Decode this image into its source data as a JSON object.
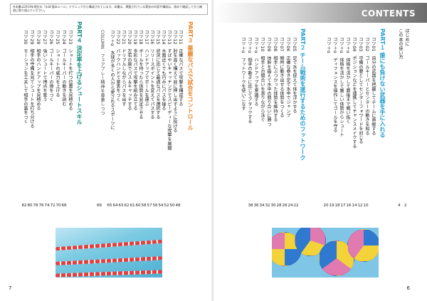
{
  "header": {
    "title": "CONTENTS",
    "note": "※本書は2019年現在の「水球 基本ルール」テクニックから構成されています。本書は、掲載されている実技の内容や構成は、改めて確認してから練習に取り組んでください。"
  },
  "intro": {
    "items": [
      {
        "label": "はじめに",
        "page": "2"
      },
      {
        "label": "この本の使い方",
        "page": "4"
      }
    ]
  },
  "part1": {
    "title": "PART１ 誰にも負けない武器を手に入れる",
    "entries": [
      {
        "no": "コツ01",
        "text": "自分の武器を把握してチームに貢献する",
        "page": "10"
      },
      {
        "no": "コツ02",
        "text": "ゴールキーパーとセンターの動きを知る",
        "page": "12"
      },
      {
        "no": "コツ03",
        "text": "守備の要としてセンターフォワードを封じる",
        "page": "14"
      },
      {
        "no": "コツ04",
        "text": "ポジションなどを連携してチャンスメイクする",
        "page": "16"
      },
      {
        "no": "コツ＋α",
        "text": "体格を活かして最後まで戦い抜く",
        "page": "17"
      },
      {
        "no": "コツ＋α",
        "text": "体格を活かして厳しい体勢からシュート",
        "page": "18"
      },
      {
        "no": "コツ＋α",
        "text": "ディフェンスを操作してゴールを守る",
        "page": "19"
      },
      {
        "no": "コツ＋α",
        "text": "",
        "page": "20"
      }
    ]
  },
  "part2": {
    "title": "PART２ チーム戦術を遂行するためのフットワーク",
    "entries": [
      {
        "no": "コツ05",
        "text": "足で水を捉えて体を浮かせる",
        "page": "22"
      },
      {
        "no": "コツ06",
        "text": "正確な巻き足で水中でジャンプ",
        "page": "24"
      },
      {
        "no": "コツ07",
        "text": "瞬時に動き出せる体勢をつくる",
        "page": "26"
      },
      {
        "no": "コツ08",
        "text": "相手にぶつかった体勢を維持する",
        "page": "28"
      },
      {
        "no": "コツ09",
        "text": "体幹を鍛えて水中の競り合いに勝つ",
        "page": "30"
      },
      {
        "no": "コツ10",
        "text": "相手との間合いを測りながら泳ぐ",
        "page": "32"
      },
      {
        "no": "コツ＋α",
        "text": "ハンドアップを意識する",
        "page": "34"
      },
      {
        "no": "コツ＋α",
        "text": "相手の動きに応じてアタックする",
        "page": "36"
      },
      {
        "no": "コツ＋α",
        "text": "フットワークを使いこなす",
        "page": "38"
      }
    ]
  },
  "part3": {
    "title": "PART３ 華麗なパスで試合をコントロール",
    "entries": [
      {
        "no": "コツ11",
        "text": "正確なパスで攻撃を構成する",
        "page": "48"
      },
      {
        "no": "コツ12",
        "text": "肘を高く構えて前に押し出すように投げる",
        "page": "50"
      },
      {
        "no": "コツ13",
        "text": "すばやいキャッチングでスピーディーな攻撃を展開",
        "page": "52"
      },
      {
        "no": "コツ14",
        "text": "水面近くでも巧みにパスを操る",
        "page": "54"
      },
      {
        "no": "コツ15",
        "text": "状況に応じて最適なパスを選択する",
        "page": "56"
      },
      {
        "no": "コツ16",
        "text": "リリースポイントを変えてパスする",
        "page": "57"
      },
      {
        "no": "コツ17",
        "text": "ハンドアップでボールを運ぶ",
        "page": "58"
      },
      {
        "no": "コツ18",
        "text": "ボールを持ったら体勢を安定させる",
        "page": "60"
      },
      {
        "no": "コツ19",
        "text": "多彩なパスで攻撃を組み立てる",
        "page": "61"
      },
      {
        "no": "コツ20",
        "text": "左右の腕でパス＆キャッチする",
        "page": "62"
      },
      {
        "no": "コツ21",
        "text": "ドリブルしながらパスを出す",
        "page": "63"
      },
      {
        "no": "コツ22",
        "text": "バックハンドで意表をつく",
        "page": "64"
      },
      {
        "no": "コツ＋α",
        "text": "水球が多くの人から愛されるスポーツに",
        "page": "65"
      }
    ],
    "column": {
      "mark": "COLUMN",
      "text": "フェアプレー精神を尊重しつつ",
      "page": "66"
    }
  },
  "part4": {
    "title": "PART４ 決定率を上げるシュートスキル",
    "entries": [
      {
        "no": "コツ23",
        "text": "シュートを打つ位置を見極める",
        "page": "68"
      },
      {
        "no": "コツ24",
        "text": "ゴールキーパーの動きを読む",
        "page": "70"
      },
      {
        "no": "コツ25",
        "text": "シュートの威力を上げる",
        "page": "72"
      },
      {
        "no": "コツ26",
        "text": "ゴールキーパーの隙をつく",
        "page": "74"
      },
      {
        "no": "コツ27",
        "text": "強いシュートで得点を奪う",
        "page": "76"
      },
      {
        "no": "コツ28",
        "text": "相手のハンドアップを見極める",
        "page": "78"
      },
      {
        "no": "コツ29",
        "text": "相手の守備を見てシュートを打ち分ける",
        "page": "80"
      },
      {
        "no": "コツ30",
        "text": "モーションを工夫して相手の裏をつく",
        "page": "82"
      }
    ]
  },
  "folio": {
    "left": "7",
    "right": "6"
  }
}
